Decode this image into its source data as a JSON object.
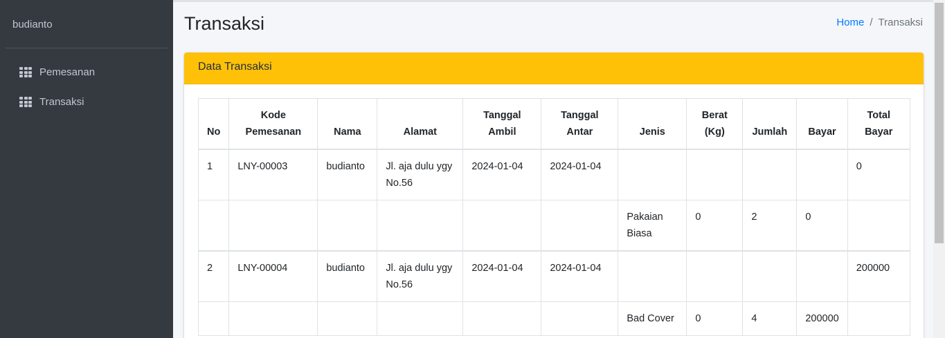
{
  "sidebar": {
    "user": "budianto",
    "items": [
      {
        "label": "Pemesanan",
        "icon": "grid-icon"
      },
      {
        "label": "Transaksi",
        "icon": "grid-icon"
      }
    ]
  },
  "page": {
    "title": "Transaksi",
    "breadcrumb": {
      "home": "Home",
      "separator": "/",
      "current": "Transaksi"
    }
  },
  "card": {
    "title": "Data Transaksi",
    "header_color": "#ffc107"
  },
  "table": {
    "headers": {
      "no": "No",
      "kode_1": "Kode",
      "kode_2": "Pemesanan",
      "nama": "Nama",
      "alamat": "Alamat",
      "ambil_1": "Tanggal",
      "ambil_2": "Ambil",
      "antar_1": "Tanggal",
      "antar_2": "Antar",
      "jenis": "Jenis",
      "berat_1": "Berat",
      "berat_2": "(Kg)",
      "jumlah": "Jumlah",
      "bayar": "Bayar",
      "total_1": "Total",
      "total_2": "Bayar"
    },
    "rows": [
      {
        "no": "1",
        "kode": "LNY-00003",
        "nama": "budianto",
        "alamat_1": "Jl. aja dulu ygy",
        "alamat_2": "No.56",
        "ambil": "2024-01-04",
        "antar": "2024-01-04",
        "total": "0",
        "detail": {
          "jenis_1": "Pakaian",
          "jenis_2": "Biasa",
          "berat": "0",
          "jumlah": "2",
          "bayar": "0"
        }
      },
      {
        "no": "2",
        "kode": "LNY-00004",
        "nama": "budianto",
        "alamat_1": "Jl. aja dulu ygy",
        "alamat_2": "No.56",
        "ambil": "2024-01-04",
        "antar": "2024-01-04",
        "total": "200000",
        "detail": {
          "jenis_1": "Bad Cover",
          "jenis_2": "",
          "berat": "0",
          "jumlah": "4",
          "bayar": "200000"
        }
      }
    ]
  }
}
